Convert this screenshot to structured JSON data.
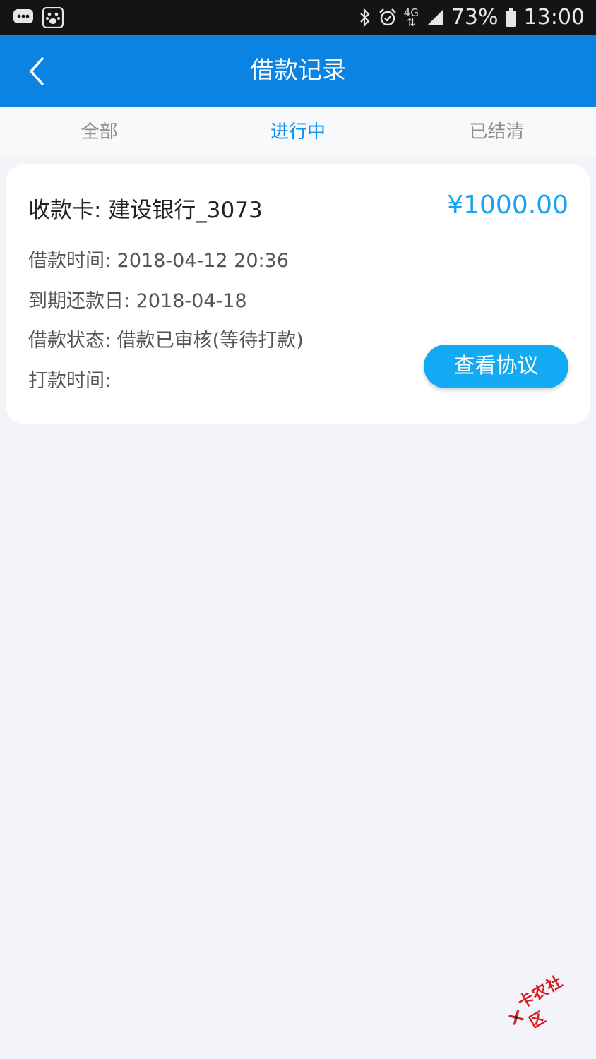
{
  "status_bar": {
    "network": "4G",
    "battery_percent": "73%",
    "time": "13:00",
    "icons": [
      "message-icon",
      "baidu-icon",
      "bluetooth-icon",
      "alarm-icon",
      "signal-icon",
      "battery-icon"
    ]
  },
  "header": {
    "title": "借款记录",
    "back_icon": "chevron-left-icon"
  },
  "tabs": [
    {
      "label": "全部",
      "active": false
    },
    {
      "label": "进行中",
      "active": true
    },
    {
      "label": "已结清",
      "active": false
    }
  ],
  "record": {
    "card_label": "收款卡: 建设银行_3073",
    "amount": "¥1000.00",
    "loan_time": "借款时间: 2018-04-12 20:36",
    "due_date": "到期还款日: 2018-04-18",
    "status": "借款状态: 借款已审核(等待打款)",
    "payout_time": "打款时间:",
    "view_agreement": "查看协议"
  },
  "watermark": {
    "text": "卡农社区"
  },
  "colors": {
    "header_bg": "#0b83e3",
    "accent": "#0b91ea",
    "amount": "#15a2ee",
    "button": "#12aaf2",
    "page_bg": "#f2f4f9"
  }
}
